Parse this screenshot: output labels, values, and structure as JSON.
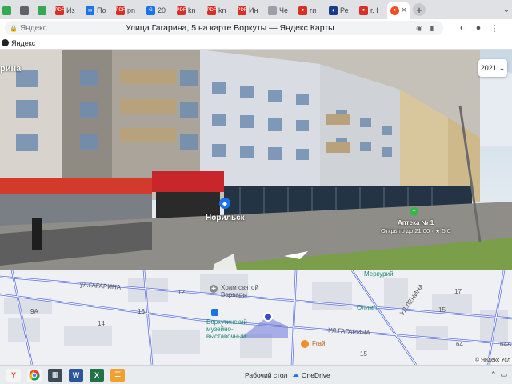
{
  "browser": {
    "tabs": [
      {
        "label": "",
        "fav_bg": "#34a853",
        "fav": ""
      },
      {
        "label": "",
        "fav_bg": "#5f6368",
        "fav": ""
      },
      {
        "label": "",
        "fav_bg": "#34a853",
        "fav": ""
      },
      {
        "label": "Из",
        "fav_bg": "#d93025",
        "fav": "PDF"
      },
      {
        "label": "По",
        "fav_bg": "#1a73e8",
        "fav": "✉"
      },
      {
        "label": "pn",
        "fav_bg": "#d93025",
        "fav": "PDF"
      },
      {
        "label": "20",
        "fav_bg": "#1a73e8",
        "fav": "G"
      },
      {
        "label": "kn",
        "fav_bg": "#d93025",
        "fav": "PDF"
      },
      {
        "label": "kn",
        "fav_bg": "#d93025",
        "fav": "PDF"
      },
      {
        "label": "Ин",
        "fav_bg": "#d93025",
        "fav": "PDF"
      },
      {
        "label": "Че",
        "fav_bg": "#9aa0a6",
        "fav": ""
      },
      {
        "label": "ги",
        "fav_bg": "#d93025",
        "fav": "●"
      },
      {
        "label": "Ре",
        "fav_bg": "#1a3a8a",
        "fav": "✦"
      },
      {
        "label": "г. I",
        "fav_bg": "#d93025",
        "fav": "●"
      }
    ],
    "active_tab": {
      "fav_bg": "#f04e23"
    },
    "new_tab": "+",
    "address": {
      "site": "Яндекс",
      "title": "Улица Гагарина, 5 на карте Воркуты — Яндекс Карты"
    },
    "bookmarks": [
      {
        "label": "Яндекс"
      }
    ]
  },
  "panorama": {
    "street_label": "рина",
    "year": "2021",
    "shop_label": "Норильск",
    "pharmacy_name": "Аптека № 1",
    "pharmacy_info": "Открыто до 21:00 · ★ 5,0"
  },
  "map": {
    "street_top": "ул.ГАГАРИНА",
    "street_bottom": "УЛ.ГАГАРИНА",
    "street_right": "УЛ.ЛЕНИНА",
    "poi_church": "Храм святой Варвары",
    "poi_museum": "Воркутинский музейно-выставочный...",
    "poi_merkury": "Меркурий",
    "poi_olimp": "Олимп",
    "poi_fraj": "Fraй",
    "house_numbers": [
      "9А",
      "14",
      "16",
      "12",
      "15",
      "17",
      "64",
      "64А",
      "15"
    ],
    "copyright": "© Яндекс  Усл"
  },
  "taskbar": {
    "desktop_label": "Рабочий стол",
    "onedrive_label": "OneDrive",
    "apps": [
      {
        "name": "yandex-browser-taskbar-icon",
        "bg": "#f4f4f4",
        "text": "Y",
        "color": "#e53935"
      },
      {
        "name": "chrome-taskbar-icon",
        "bg": "#f4f4f4",
        "text": "",
        "color": ""
      },
      {
        "name": "calculator-taskbar-icon",
        "bg": "#3d4a57",
        "text": "▦",
        "color": "#fff"
      },
      {
        "name": "word-taskbar-icon",
        "bg": "#2b579a",
        "text": "W",
        "color": "#fff"
      },
      {
        "name": "excel-taskbar-icon",
        "bg": "#217346",
        "text": "X",
        "color": "#fff"
      },
      {
        "name": "reader-taskbar-icon",
        "bg": "#f0a030",
        "text": "☰",
        "color": "#fff"
      }
    ]
  },
  "colors": {
    "accent": "#f04e23",
    "map_road": "#5b6fe0",
    "pharmacy_green": "#3ab54a"
  }
}
